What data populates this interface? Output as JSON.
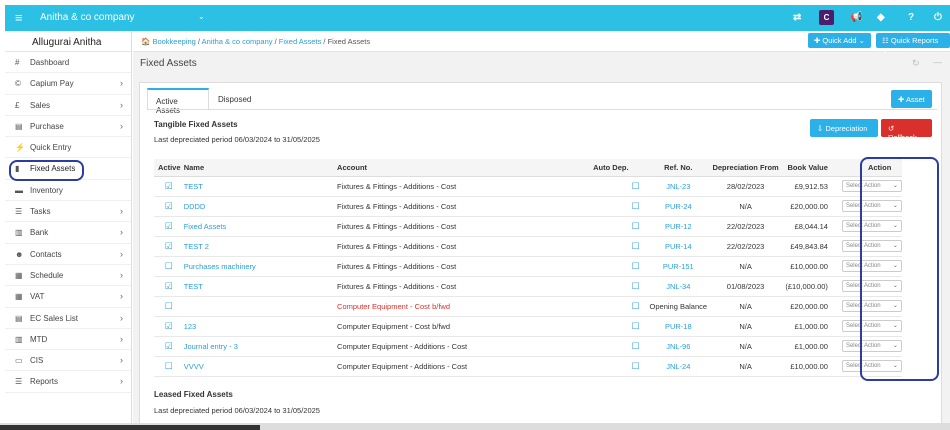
{
  "topbar": {
    "company": "Anitha & co company"
  },
  "sidebar": {
    "user": "Allugurai Anitha",
    "items": [
      {
        "label": "Dashboard",
        "icon": "#",
        "arrow": ""
      },
      {
        "label": "Capium Pay",
        "icon": "©",
        "arrow": "›"
      },
      {
        "label": "Sales",
        "icon": "£",
        "arrow": "›"
      },
      {
        "label": "Purchase",
        "icon": "▤",
        "arrow": "›"
      },
      {
        "label": "Quick Entry",
        "icon": "⚡",
        "arrow": ""
      },
      {
        "label": "Fixed Assets",
        "icon": "▮",
        "arrow": ""
      },
      {
        "label": "Inventory",
        "icon": "▬",
        "arrow": ""
      },
      {
        "label": "Tasks",
        "icon": "☰",
        "arrow": "›"
      },
      {
        "label": "Bank",
        "icon": "▥",
        "arrow": "›"
      },
      {
        "label": "Contacts",
        "icon": "☻",
        "arrow": "›"
      },
      {
        "label": "Schedule",
        "icon": "▦",
        "arrow": "›"
      },
      {
        "label": "VAT",
        "icon": "▦",
        "arrow": "›"
      },
      {
        "label": "EC Sales List",
        "icon": "▤",
        "arrow": "›"
      },
      {
        "label": "MTD",
        "icon": "▥",
        "arrow": "›"
      },
      {
        "label": "CIS",
        "icon": "▭",
        "arrow": "›"
      },
      {
        "label": "Reports",
        "icon": "☰",
        "arrow": "›"
      }
    ]
  },
  "breadcrumb": {
    "b1": "Bookkeeping",
    "b2": "Anitha & co company",
    "b3": "Fixed Assets",
    "b4": "Fixed Assets"
  },
  "header_buttons": {
    "quick_add": "Quick Add",
    "quick_reports": "Quick Reports"
  },
  "page": {
    "title": "Fixed Assets"
  },
  "tabs": {
    "active": "Active Assets",
    "disposed": "Disposed"
  },
  "buttons": {
    "asset": "Asset",
    "depreciation": "Depreciation",
    "rollback": "Rollback"
  },
  "tangible": {
    "title": "Tangible Fixed Assets",
    "period": "Last depreciated period 06/03/2024 to 31/05/2025"
  },
  "leased": {
    "title": "Leased Fixed Assets",
    "period": "Last depreciated period 06/03/2024 to 31/05/2025"
  },
  "table": {
    "headers": {
      "active": "Active",
      "name": "Name",
      "account": "Account",
      "auto": "Auto Dep.",
      "ref": "Ref. No.",
      "dep_from": "Depreciation From",
      "book": "Book Value",
      "action": "Action"
    },
    "select_placeholder": "Select Action",
    "rows": [
      {
        "active": "☑",
        "name": "TEST",
        "account": "Fixtures & Fittings - Additions - Cost",
        "auto": "☐",
        "ref": "JNL-23",
        "dep_from": "28/02/2023",
        "book": "£9,912.53",
        "red": false
      },
      {
        "active": "☑",
        "name": "DDDD",
        "account": "Fixtures & Fittings - Additions - Cost",
        "auto": "☐",
        "ref": "PUR-24",
        "dep_from": "N/A",
        "book": "£20,000.00",
        "red": false
      },
      {
        "active": "☑",
        "name": "Fixed Assets",
        "account": "Fixtures & Fittings - Additions - Cost",
        "auto": "☐",
        "ref": "PUR-12",
        "dep_from": "22/02/2023",
        "book": "£8,044.14",
        "red": false
      },
      {
        "active": "☑",
        "name": "TEST 2",
        "account": "Fixtures & Fittings - Additions - Cost",
        "auto": "☐",
        "ref": "PUR-14",
        "dep_from": "22/02/2023",
        "book": "£49,843.84",
        "red": false
      },
      {
        "active": "☐",
        "name": "Purchases machinery",
        "account": "Fixtures & Fittings - Additions - Cost",
        "auto": "☐",
        "ref": "PUR-151",
        "dep_from": "N/A",
        "book": "£10,000.00",
        "red": false
      },
      {
        "active": "☑",
        "name": "TEST",
        "account": "Fixtures & Fittings - Additions - Cost",
        "auto": "☐",
        "ref": "JNL-34",
        "dep_from": "01/08/2023",
        "book": "(£10,000.00)",
        "red": false
      },
      {
        "active": "☐",
        "name": "",
        "account": "Computer Equipment - Cost b/fwd",
        "auto": "☐",
        "ref": "Opening Balance",
        "dep_from": "N/A",
        "book": "£20,000.00",
        "red": true
      },
      {
        "active": "☑",
        "name": "123",
        "account": "Computer Equipment - Cost b/fwd",
        "auto": "☐",
        "ref": "PUR-18",
        "dep_from": "N/A",
        "book": "£1,000.00",
        "red": false
      },
      {
        "active": "☑",
        "name": "Journal entry - 3",
        "account": "Computer Equipment - Additions - Cost",
        "auto": "☐",
        "ref": "JNL-96",
        "dep_from": "N/A",
        "book": "£1,000.00",
        "red": false
      },
      {
        "active": "☐",
        "name": "VVVV",
        "account": "Computer Equipment - Additions - Cost",
        "auto": "☐",
        "ref": "JNL-24",
        "dep_from": "N/A",
        "book": "£10,000.00",
        "red": false
      }
    ]
  }
}
